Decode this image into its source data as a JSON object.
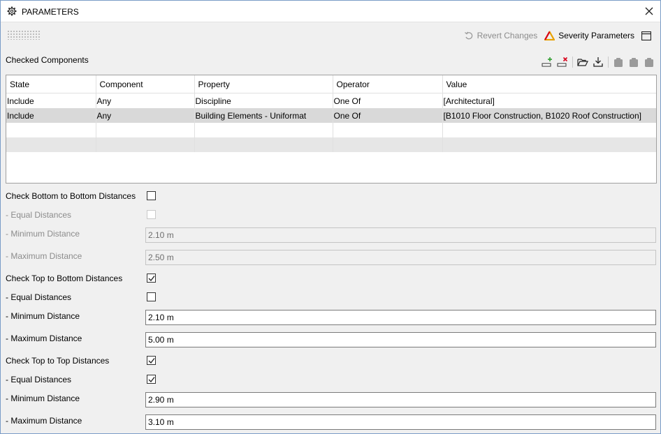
{
  "window": {
    "title": "PARAMETERS"
  },
  "toolbar": {
    "revert_label": "Revert Changes",
    "severity_label": "Severity Parameters"
  },
  "checked_components": {
    "label": "Checked Components",
    "columns": [
      "State",
      "Component",
      "Property",
      "Operator",
      "Value"
    ],
    "rows": [
      [
        "Include",
        "Any",
        "Discipline",
        "One Of",
        "[Architectural]"
      ],
      [
        "Include",
        "Any",
        "Building Elements - Uniformat",
        "One Of",
        "[B1010 Floor Construction, B1020 Roof Construction]"
      ]
    ]
  },
  "form": {
    "b2b": {
      "check_label": "Check Bottom to Bottom Distances",
      "checked": false,
      "equal_label": "- Equal Distances",
      "equal_checked": false,
      "min_label": "- Minimum Distance",
      "min_value": "2.10 m",
      "max_label": "- Maximum Distance",
      "max_value": "2.50 m"
    },
    "t2b": {
      "check_label": "Check Top to Bottom Distances",
      "checked": true,
      "equal_label": "- Equal Distances",
      "equal_checked": false,
      "min_label": "- Minimum Distance",
      "min_value": "2.10 m",
      "max_label": "- Maximum Distance",
      "max_value": "5.00 m"
    },
    "t2t": {
      "check_label": "Check Top to Top Distances",
      "checked": true,
      "equal_label": "- Equal Distances",
      "equal_checked": true,
      "min_label": "- Minimum Distance",
      "min_value": "2.90 m",
      "max_label": "- Maximum Distance",
      "max_value": "3.10 m"
    }
  },
  "colors": {
    "accent": "#e8a100",
    "danger": "#d9001b",
    "add": "#2e9e2e"
  }
}
